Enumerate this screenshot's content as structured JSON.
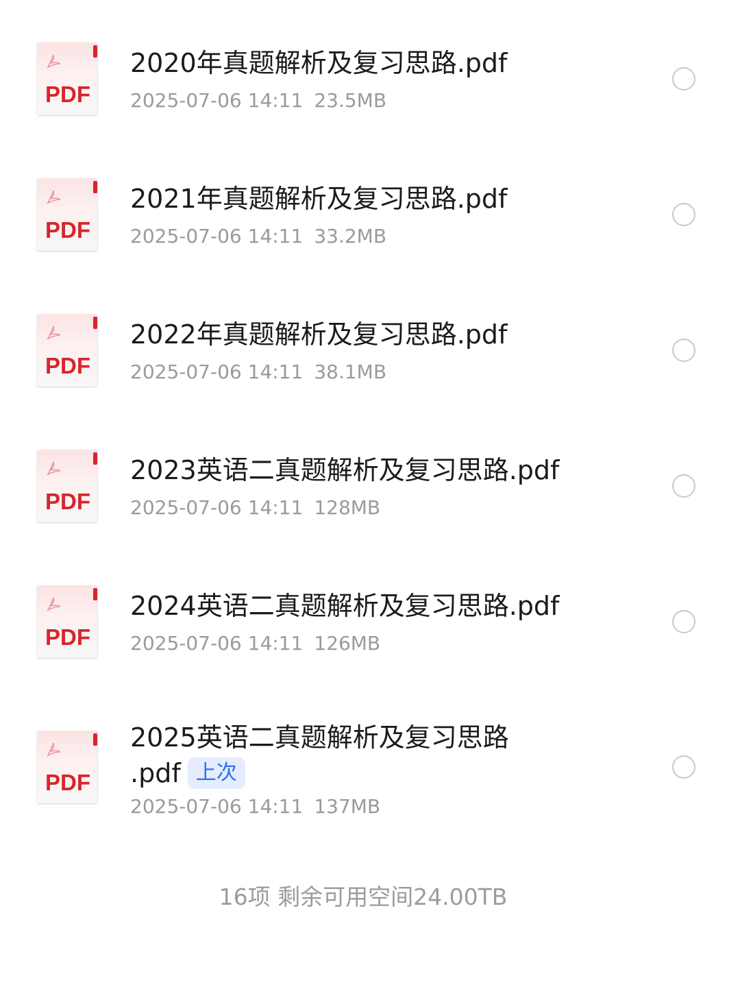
{
  "files": [
    {
      "name": "2020年真题解析及复习思路.pdf",
      "date": "2025-07-06 14:11",
      "size": "23.5MB",
      "icon": "pdf-file-icon",
      "icon_label": "PDF",
      "selected": false
    },
    {
      "name": "2021年真题解析及复习思路.pdf",
      "date": "2025-07-06 14:11",
      "size": "33.2MB",
      "icon": "pdf-file-icon",
      "icon_label": "PDF",
      "selected": false
    },
    {
      "name": "2022年真题解析及复习思路.pdf",
      "date": "2025-07-06 14:11",
      "size": "38.1MB",
      "icon": "pdf-file-icon",
      "icon_label": "PDF",
      "selected": false
    },
    {
      "name": "2023英语二真题解析及复习思路.pdf",
      "date": "2025-07-06 14:11",
      "size": "128MB",
      "icon": "pdf-file-icon",
      "icon_label": "PDF",
      "selected": false
    },
    {
      "name": "2024英语二真题解析及复习思路.pdf",
      "date": "2025-07-06 14:11",
      "size": "126MB",
      "icon": "pdf-file-icon",
      "icon_label": "PDF",
      "selected": false
    },
    {
      "name_line1": "2025英语二真题解析及复习思路",
      "name_line2": ".pdf",
      "badge": "上次",
      "date": "2025-07-06 14:11",
      "size": "137MB",
      "icon": "pdf-file-icon",
      "icon_label": "PDF",
      "selected": false
    }
  ],
  "footer": {
    "summary": "16项 剩余可用空间24.00TB"
  },
  "colors": {
    "pdf_red": "#d8252c",
    "badge_bg": "#e4ecfd",
    "badge_text": "#2f6fe6",
    "meta_gray": "#9a9a9a"
  }
}
